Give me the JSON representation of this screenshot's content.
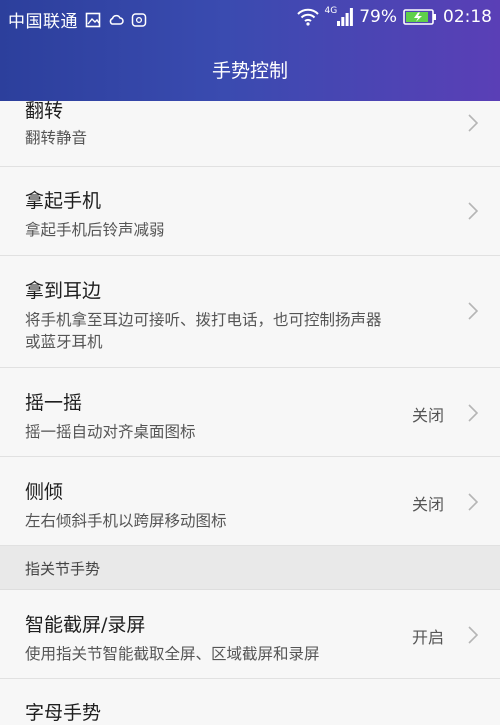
{
  "status_bar": {
    "carrier": "中国联通",
    "network": "4G",
    "battery": "79%",
    "time": "02:18",
    "icons": [
      "image-icon",
      "cloud-icon",
      "app-notification-icon",
      "wifi-icon",
      "signal-icon",
      "battery-charging-icon"
    ]
  },
  "header": {
    "title": "手势控制"
  },
  "rows": [
    {
      "title": "翻转",
      "subtitle": "翻转静音",
      "value": ""
    },
    {
      "title": "拿起手机",
      "subtitle": "拿起手机后铃声减弱",
      "value": ""
    },
    {
      "title": "拿到耳边",
      "subtitle": "将手机拿至耳边可接听、拨打电话，也可控制扬声器或蓝牙耳机",
      "value": ""
    },
    {
      "title": "摇一摇",
      "subtitle": "摇一摇自动对齐桌面图标",
      "value": "关闭"
    },
    {
      "title": "侧倾",
      "subtitle": "左右倾斜手机以跨屏移动图标",
      "value": "关闭"
    }
  ],
  "section": {
    "label": "指关节手势"
  },
  "rows2": [
    {
      "title": "智能截屏/录屏",
      "subtitle": "使用指关节智能截取全屏、区域截屏和录屏",
      "value": "开启"
    },
    {
      "title": "字母手势",
      "subtitle": "",
      "value": ""
    }
  ],
  "colors": {
    "header_start": "#2c3f9c",
    "header_end": "#5a3fb6",
    "background": "#f7f7f7",
    "section_bg": "#e9e9e9"
  }
}
